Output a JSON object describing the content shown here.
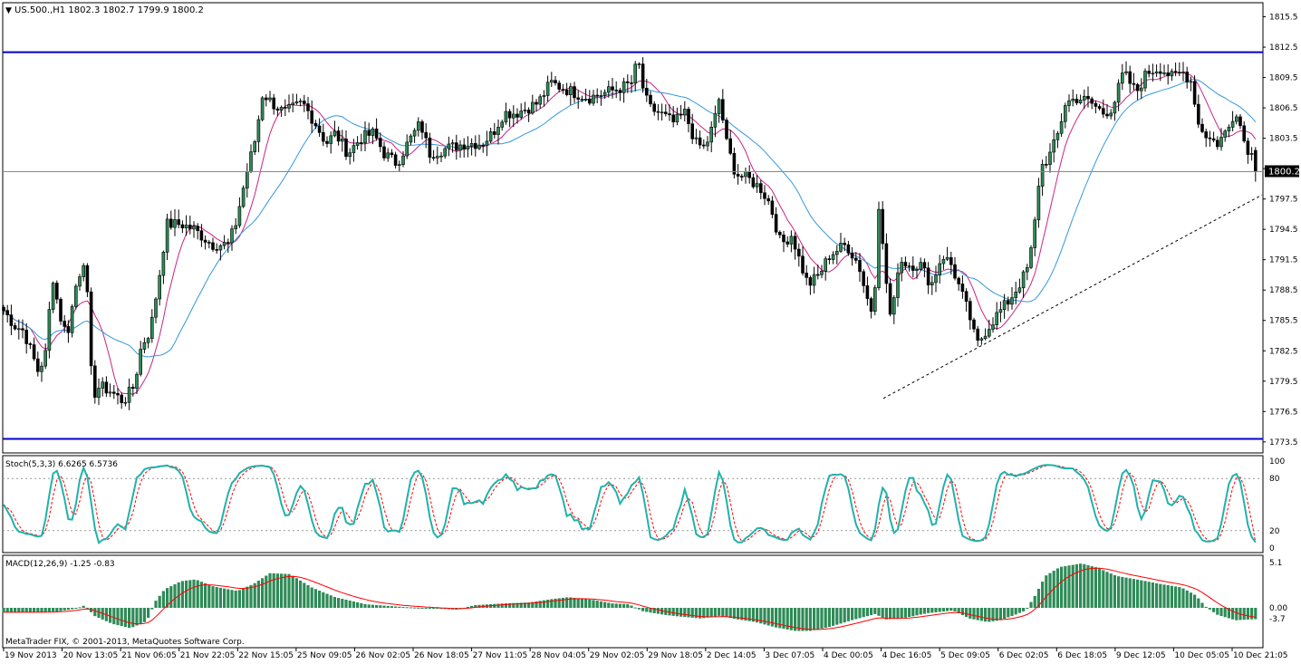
{
  "main": {
    "symbol": "US.500.,H1",
    "ohlc": "1802.3 1802.7 1799.9 1800.2",
    "header_text": "US.500.,H1  1802.3 1802.7 1799.9 1800.2",
    "current_price": "1800.2",
    "price_ticks": [
      "1815.5",
      "1812.5",
      "1809.5",
      "1806.5",
      "1803.5",
      "1800.5",
      "1797.5",
      "1794.5",
      "1791.5",
      "1788.5",
      "1785.5",
      "1782.5",
      "1779.5",
      "1776.5",
      "1773.5"
    ]
  },
  "stoch": {
    "label": "Stoch(5,3,3) 6.6265 6.5736",
    "ticks": [
      "100",
      "80",
      "20",
      "0"
    ]
  },
  "macd": {
    "label": "MACD(12,26,9) -1.25 -0.83",
    "ticks": [
      "5.1",
      "0.00",
      "-3.7"
    ]
  },
  "copyright": "MetaTrader FIX, © 2001-2013, MetaQuotes Software Corp.",
  "time_labels": [
    "19 Nov 2013",
    "20 Nov 13:05",
    "21 Nov 06:05",
    "21 Nov 22:05",
    "22 Nov 15:05",
    "25 Nov 09:05",
    "26 Nov 02:05",
    "26 Nov 18:05",
    "27 Nov 11:05",
    "28 Nov 04:05",
    "29 Nov 02:05",
    "29 Nov 18:05",
    "2 Dec 14:05",
    "3 Dec 07:05",
    "4 Dec 00:05",
    "4 Dec 16:05",
    "5 Dec 09:05",
    "6 Dec 02:05",
    "6 Dec 18:05",
    "9 Dec 12:05",
    "10 Dec 05:05",
    "10 Dec 21:05"
  ],
  "colors": {
    "bull": "#2e8b57",
    "bear": "#000000",
    "ma_fast": "#cc2288",
    "ma_slow": "#3399dd",
    "hline": "#0000cc",
    "stoch_main": "#20b2aa",
    "stoch_signal": "#ff0000",
    "macd_hist": "#2e8b57",
    "macd_signal": "#ff0000"
  },
  "chart_data": {
    "type": "candlestick",
    "instrument": "US.500.",
    "timeframe": "H1",
    "last_ohlc": [
      1802.3,
      1802.7,
      1799.9,
      1800.2
    ],
    "ylim": [
      1772.5,
      1816.8
    ],
    "horizontal_levels": [
      1812.0,
      1773.8
    ],
    "trendline": {
      "from": [
        1777.8
      ],
      "to": [
        1797.9
      ]
    },
    "path_anchors": [
      [
        0,
        1786.5
      ],
      [
        12,
        1785
      ],
      [
        22,
        1784.5
      ],
      [
        28,
        1783
      ],
      [
        38,
        1780.5
      ],
      [
        46,
        1782
      ],
      [
        54,
        1790
      ],
      [
        62,
        1786
      ],
      [
        70,
        1784
      ],
      [
        80,
        1789
      ],
      [
        90,
        1792
      ],
      [
        98,
        1778
      ],
      [
        106,
        1779
      ],
      [
        118,
        1778.5
      ],
      [
        132,
        1777.5
      ],
      [
        144,
        1779
      ],
      [
        152,
        1783
      ],
      [
        162,
        1784.5
      ],
      [
        172,
        1790
      ],
      [
        180,
        1795
      ],
      [
        196,
        1795
      ],
      [
        210,
        1794.5
      ],
      [
        230,
        1793
      ],
      [
        248,
        1793
      ],
      [
        256,
        1795
      ],
      [
        268,
        1800
      ],
      [
        278,
        1803.5
      ],
      [
        286,
        1808
      ],
      [
        296,
        1807
      ],
      [
        310,
        1806
      ],
      [
        330,
        1807
      ],
      [
        344,
        1805
      ],
      [
        356,
        1803
      ],
      [
        366,
        1804
      ],
      [
        380,
        1802
      ],
      [
        394,
        1803.5
      ],
      [
        408,
        1804
      ],
      [
        420,
        1802
      ],
      [
        434,
        1801
      ],
      [
        446,
        1803
      ],
      [
        460,
        1805
      ],
      [
        470,
        1802
      ],
      [
        490,
        1802.5
      ],
      [
        510,
        1803
      ],
      [
        528,
        1803
      ],
      [
        540,
        1804
      ],
      [
        552,
        1806
      ],
      [
        566,
        1806
      ],
      [
        590,
        1807
      ],
      [
        604,
        1809
      ],
      [
        616,
        1808.5
      ],
      [
        630,
        1808
      ],
      [
        646,
        1807.5
      ],
      [
        664,
        1808
      ],
      [
        682,
        1808.5
      ],
      [
        694,
        1809
      ],
      [
        700,
        1811.5
      ],
      [
        704,
        1809
      ],
      [
        712,
        1806.5
      ],
      [
        724,
        1806
      ],
      [
        740,
        1805
      ],
      [
        752,
        1806
      ],
      [
        764,
        1803
      ],
      [
        774,
        1802.5
      ],
      [
        784,
        1805
      ],
      [
        790,
        1807.5
      ],
      [
        798,
        1803
      ],
      [
        808,
        1800
      ],
      [
        822,
        1799.5
      ],
      [
        836,
        1798.5
      ],
      [
        846,
        1797
      ],
      [
        858,
        1793
      ],
      [
        870,
        1794
      ],
      [
        880,
        1791
      ],
      [
        888,
        1789
      ],
      [
        900,
        1790
      ],
      [
        912,
        1792
      ],
      [
        930,
        1793
      ],
      [
        944,
        1791
      ],
      [
        952,
        1788
      ],
      [
        960,
        1786
      ],
      [
        966,
        1797
      ],
      [
        972,
        1791
      ],
      [
        980,
        1785
      ],
      [
        988,
        1791.5
      ],
      [
        1000,
        1791
      ],
      [
        1012,
        1791
      ],
      [
        1024,
        1789
      ],
      [
        1036,
        1792
      ],
      [
        1046,
        1791
      ],
      [
        1054,
        1789
      ],
      [
        1066,
        1786
      ],
      [
        1074,
        1783
      ],
      [
        1084,
        1784.5
      ],
      [
        1096,
        1786
      ],
      [
        1110,
        1787.5
      ],
      [
        1124,
        1789.5
      ],
      [
        1132,
        1791
      ],
      [
        1138,
        1795
      ],
      [
        1144,
        1800.5
      ],
      [
        1156,
        1802
      ],
      [
        1164,
        1804
      ],
      [
        1172,
        1807
      ],
      [
        1186,
        1807.5
      ],
      [
        1200,
        1807
      ],
      [
        1214,
        1806
      ],
      [
        1224,
        1806.5
      ],
      [
        1236,
        1810
      ],
      [
        1250,
        1808
      ],
      [
        1262,
        1810
      ],
      [
        1276,
        1810.5
      ],
      [
        1290,
        1809.5
      ],
      [
        1302,
        1810
      ],
      [
        1312,
        1809
      ],
      [
        1318,
        1805
      ],
      [
        1330,
        1803.5
      ],
      [
        1340,
        1803
      ],
      [
        1352,
        1804.5
      ],
      [
        1360,
        1806.5
      ],
      [
        1370,
        1803
      ],
      [
        1380,
        1801.5
      ],
      [
        1388,
        1800.2
      ]
    ],
    "stochastic": {
      "k_period": 5,
      "d_period": 3,
      "slowing": 3,
      "main": 6.6265,
      "signal": 6.5736,
      "levels": [
        20,
        80
      ],
      "ylim": [
        0,
        100
      ]
    },
    "macd": {
      "fast": 12,
      "slow": 26,
      "signal": 9,
      "main": -1.25,
      "signal_value": -0.83,
      "ylim": [
        -3.7,
        5.1
      ],
      "hist_anchors": [
        [
          0,
          -0.5
        ],
        [
          40,
          -0.5
        ],
        [
          60,
          -0.4
        ],
        [
          80,
          -0.1
        ],
        [
          90,
          0.3
        ],
        [
          100,
          -0.9
        ],
        [
          120,
          -1.8
        ],
        [
          140,
          -2.3
        ],
        [
          158,
          -1.5
        ],
        [
          168,
          0.8
        ],
        [
          178,
          2.1
        ],
        [
          196,
          3.0
        ],
        [
          212,
          3.2
        ],
        [
          232,
          2.4
        ],
        [
          258,
          1.9
        ],
        [
          276,
          2.7
        ],
        [
          294,
          3.9
        ],
        [
          316,
          3.8
        ],
        [
          340,
          2.3
        ],
        [
          366,
          1.2
        ],
        [
          400,
          0.4
        ],
        [
          440,
          0.1
        ],
        [
          480,
          -0.1
        ],
        [
          500,
          -0.2
        ],
        [
          520,
          0.3
        ],
        [
          552,
          0.5
        ],
        [
          580,
          0.6
        ],
        [
          606,
          1.0
        ],
        [
          624,
          1.2
        ],
        [
          650,
          0.9
        ],
        [
          672,
          0.5
        ],
        [
          690,
          0.4
        ],
        [
          706,
          -0.4
        ],
        [
          730,
          -0.8
        ],
        [
          748,
          -1.0
        ],
        [
          770,
          -1.2
        ],
        [
          790,
          -0.9
        ],
        [
          810,
          -1.3
        ],
        [
          830,
          -1.6
        ],
        [
          852,
          -2.2
        ],
        [
          874,
          -2.6
        ],
        [
          890,
          -2.6
        ],
        [
          910,
          -2.2
        ],
        [
          936,
          -1.4
        ],
        [
          962,
          -0.7
        ],
        [
          974,
          -1.3
        ],
        [
          996,
          -1.1
        ],
        [
          1020,
          -0.6
        ],
        [
          1048,
          -0.3
        ],
        [
          1066,
          -1.2
        ],
        [
          1086,
          -1.6
        ],
        [
          1100,
          -1.4
        ],
        [
          1116,
          -0.8
        ],
        [
          1128,
          -0.3
        ],
        [
          1138,
          1.3
        ],
        [
          1150,
          3.6
        ],
        [
          1166,
          4.6
        ],
        [
          1190,
          5.0
        ],
        [
          1208,
          4.5
        ],
        [
          1228,
          3.6
        ],
        [
          1256,
          3.1
        ],
        [
          1276,
          2.7
        ],
        [
          1300,
          2.3
        ],
        [
          1316,
          1.4
        ],
        [
          1326,
          0.2
        ],
        [
          1340,
          -0.8
        ],
        [
          1360,
          -1.4
        ],
        [
          1376,
          -1.3
        ],
        [
          1388,
          -1.25
        ]
      ]
    }
  }
}
